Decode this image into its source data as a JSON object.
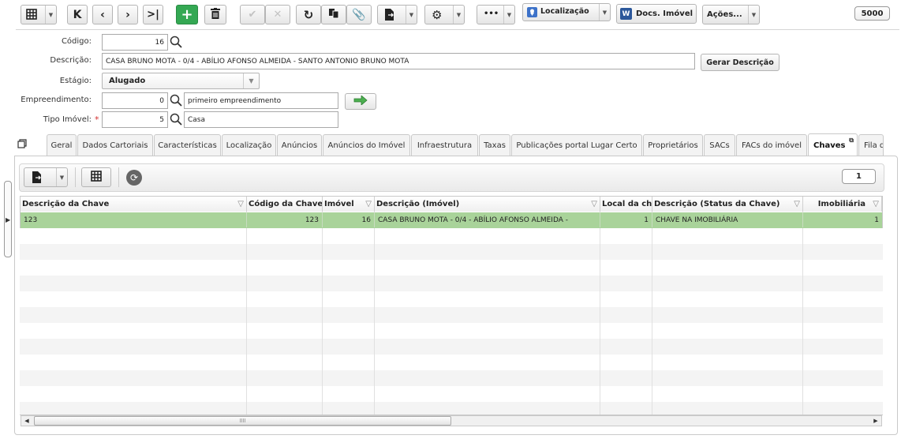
{
  "toolbar": {
    "counter": "5000",
    "localizacao_label": "Localização",
    "docs_label": "Docs. Imóvel",
    "acoes_label": "Ações...",
    "more_label": "•••"
  },
  "form": {
    "codigo_label": "Código:",
    "codigo_value": "16",
    "descricao_label": "Descrição:",
    "descricao_value": "CASA BRUNO MOTA - 0/4 - ABÍLIO AFONSO ALMEIDA - SANTO ANTONIO BRUNO MOTA",
    "gerar_label": "Gerar Descrição",
    "estagio_label": "Estágio:",
    "estagio_value": "Alugado",
    "empreendimento_label": "Empreendimento:",
    "empreendimento_code": "0",
    "empreendimento_name": "primeiro empreendimento",
    "tipo_label": "Tipo Imóvel:",
    "tipo_required": "*",
    "tipo_code": "5",
    "tipo_name": "Casa"
  },
  "tabs": [
    "Geral",
    "Dados Cartoriais",
    "Características",
    "Localização",
    "Anúncios",
    "Anúncios do Imóvel",
    "Infraestrutura",
    "Taxas",
    "Publicações portal Lugar Certo",
    "Proprietários",
    "SACs",
    "FACs do imóvel",
    "Chaves",
    "Fila d"
  ],
  "grid": {
    "page": "1",
    "columns": [
      "Descrição da Chave",
      "Código da Chave",
      "Imóvel",
      "Descrição (Imóvel)",
      "Local da ch",
      "Descrição (Status da Chave)",
      "Imobiliária"
    ],
    "rows": [
      [
        "123",
        "123",
        "16",
        "CASA BRUNO MOTA - 0/4 - ABÍLIO AFONSO ALMEIDA -",
        "1",
        "CHAVE NA IMOBILIÁRIA",
        "1"
      ]
    ]
  },
  "colors": {
    "selected_row": "#a9d39a",
    "accent": "#34a853"
  }
}
